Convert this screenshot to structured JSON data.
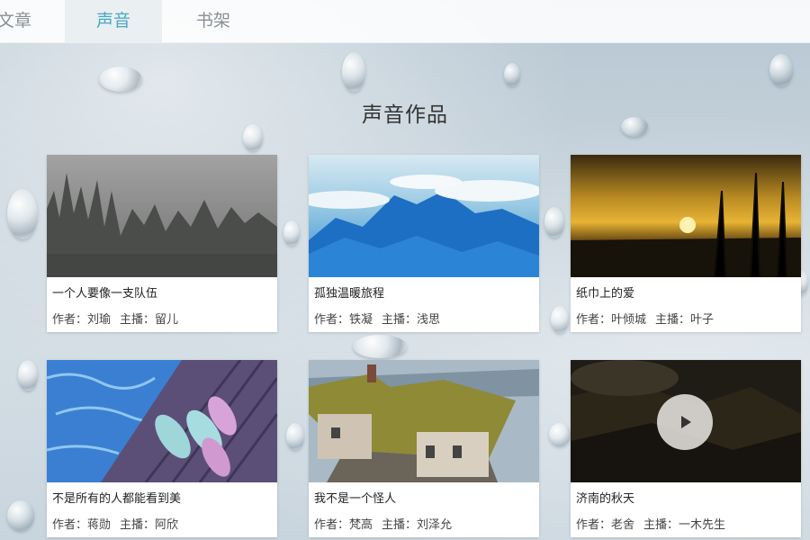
{
  "nav": {
    "tabs": [
      {
        "label": "文章"
      },
      {
        "label": "声音"
      },
      {
        "label": "书架"
      }
    ],
    "active_tab": "声音"
  },
  "section": {
    "title": "声音作品"
  },
  "works": [
    {
      "title": "一个人要像一支队伍",
      "author_label": "作者：",
      "author": "刘瑜",
      "host_label": "主播：",
      "host": "留儿",
      "image": "misty-forest"
    },
    {
      "title": "孤独温暖旅程",
      "author_label": "作者：",
      "author": "铁凝",
      "host_label": "主播：",
      "host": "浅思",
      "image": "mountains-above-clouds"
    },
    {
      "title": "纸巾上的爱",
      "author_label": "作者：",
      "author": "叶倾城",
      "host_label": "主播：",
      "host": "叶子",
      "image": "golden-sunset"
    },
    {
      "title": "不是所有的人都能看到美",
      "author_label": "作者：",
      "author": "蒋勋",
      "host_label": "主播：",
      "host": "阿欣",
      "image": "flip-flops-by-pool"
    },
    {
      "title": "我不是一个怪人",
      "author_label": "作者：",
      "author": "梵高",
      "host_label": "主播：",
      "host": "刘泽允",
      "image": "old-house"
    },
    {
      "title": "济南的秋天",
      "author_label": "作者：",
      "author": "老舍",
      "host_label": "主播：",
      "host": "一木先生",
      "image": "dark-hillside-video"
    }
  ],
  "icons": {
    "play": "play-icon"
  },
  "colors": {
    "active_tab_text": "#48a8c6",
    "tab_text": "#8a8f95"
  }
}
